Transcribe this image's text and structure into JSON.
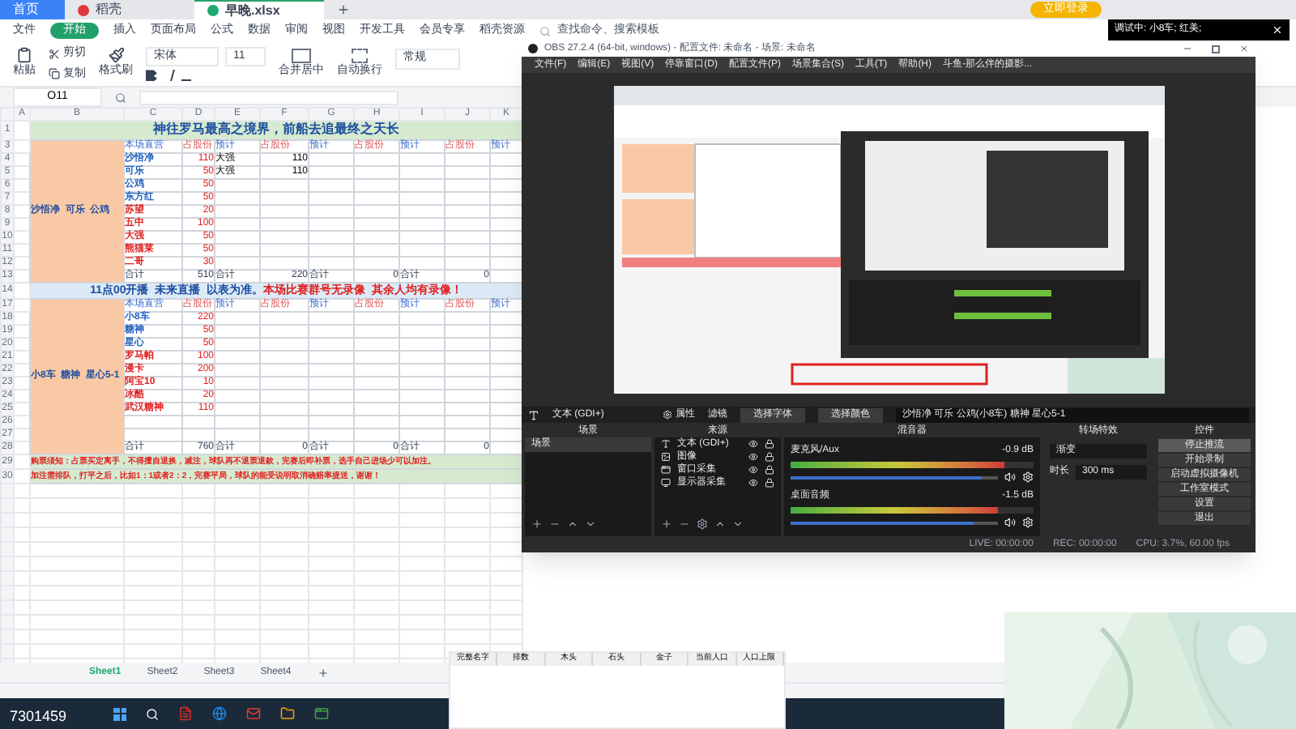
{
  "tabs": [
    {
      "label": "首页",
      "kind": "home",
      "selected": false
    },
    {
      "label": "稻壳",
      "kind": "docer",
      "selected": false
    },
    {
      "label": "早晚.xlsx",
      "kind": "sheet",
      "selected": true
    }
  ],
  "login": "立即登录",
  "menu": [
    {
      "label": "文件",
      "selected": false
    },
    {
      "label": "开始",
      "selected": true
    },
    {
      "label": "插入",
      "selected": false
    },
    {
      "label": "页面布局",
      "selected": false
    },
    {
      "label": "公式",
      "selected": false
    },
    {
      "label": "数据",
      "selected": false
    },
    {
      "label": "审阅",
      "selected": false
    },
    {
      "label": "视图",
      "selected": false
    },
    {
      "label": "开发工具",
      "selected": false
    },
    {
      "label": "会员专享",
      "selected": false
    },
    {
      "label": "稻壳资源",
      "selected": false
    }
  ],
  "search": {
    "placeholder": "查找命令、搜索模板"
  },
  "toolbar": {
    "paste": "粘贴",
    "cut": "剪切",
    "copy": "复制",
    "painter": "格式刷",
    "font": "宋体",
    "size": "11",
    "merge": "合并居中",
    "wrap": "自动换行",
    "format": "常规"
  },
  "name_box": "O11",
  "notification": {
    "text": "调试中: 小8车; 红美;"
  },
  "sheet": {
    "columns": [
      "A",
      "B",
      "C",
      "D",
      "E",
      "F",
      "G",
      "H",
      "I",
      "J",
      "K"
    ],
    "title": {
      "num": "1",
      "text": "神往罗马最高之境界，前船去追最终之天长"
    },
    "groups": [
      {
        "label": "沙悟净  可乐  公鸡",
        "rows": [
          {
            "num": "3",
            "kind": "header",
            "cells": [
              "本场直营",
              "占股份",
              "预计",
              "占股份",
              "预计",
              "占股份",
              "预计",
              "占股份",
              "预计"
            ]
          },
          {
            "num": "4",
            "kind": "entry",
            "color": "#1f5fbf",
            "cells": [
              "沙悟净",
              "110",
              "大强",
              "110"
            ]
          },
          {
            "num": "5",
            "kind": "entry",
            "color": "#1f5fbf",
            "cells": [
              "可乐",
              "50",
              "大强",
              "110"
            ]
          },
          {
            "num": "6",
            "kind": "entry",
            "color": "#1f5fbf",
            "cells": [
              "公鸡",
              "50"
            ]
          },
          {
            "num": "7",
            "kind": "entry",
            "color": "#1f5fbf",
            "cells": [
              "东方红",
              "50"
            ]
          },
          {
            "num": "8",
            "kind": "entry",
            "color": "#e02020",
            "cells": [
              "苏望",
              "20"
            ]
          },
          {
            "num": "9",
            "kind": "entry",
            "color": "#e02020",
            "cells": [
              "五中",
              "100"
            ]
          },
          {
            "num": "10",
            "kind": "entry",
            "color": "#e02020",
            "cells": [
              "大强",
              "50"
            ]
          },
          {
            "num": "11",
            "kind": "entry",
            "color": "#e02020",
            "cells": [
              "熊猫莱",
              "50"
            ]
          },
          {
            "num": "12",
            "kind": "entry",
            "color": "#e02020",
            "cells": [
              "二哥",
              "30"
            ]
          },
          {
            "num": "13",
            "kind": "total",
            "cells": [
              "合计",
              "510",
              "合计",
              "220",
              "合计",
              "0",
              "合计",
              "0"
            ]
          }
        ]
      },
      {
        "label": "11点00开播  未来直播  以表为准。",
        "alert": "本场比赛群号无录像  其余人均有录像！",
        "num": "14",
        "kind": "banner"
      },
      {
        "label": "小8车  糖神  星心5-1",
        "rows": [
          {
            "num": "17",
            "kind": "header",
            "cells": [
              "本场直营",
              "占股份",
              "预计",
              "占股份",
              "预计",
              "占股份",
              "预计",
              "占股份",
              "预计"
            ]
          },
          {
            "num": "18",
            "kind": "entry",
            "color": "#1f5fbf",
            "cells": [
              "小8车",
              "220"
            ]
          },
          {
            "num": "19",
            "kind": "entry",
            "color": "#1f5fbf",
            "cells": [
              "糖神",
              "50"
            ]
          },
          {
            "num": "20",
            "kind": "entry",
            "color": "#1f5fbf",
            "cells": [
              "星心",
              "50"
            ]
          },
          {
            "num": "21",
            "kind": "entry",
            "color": "#e02020",
            "cells": [
              "罗马帕",
              "100"
            ]
          },
          {
            "num": "22",
            "kind": "entry",
            "color": "#e02020",
            "cells": [
              "漫卡",
              "200"
            ]
          },
          {
            "num": "23",
            "kind": "entry",
            "color": "#e02020",
            "cells": [
              "阿宝10",
              "10"
            ]
          },
          {
            "num": "24",
            "kind": "entry",
            "color": "#e02020",
            "cells": [
              "冰酷",
              "20"
            ]
          },
          {
            "num": "25",
            "kind": "entry",
            "color": "#e02020",
            "cells": [
              "武汉糖神",
              "110"
            ]
          },
          {
            "num": "26",
            "kind": "blank",
            "cells": []
          },
          {
            "num": "27",
            "kind": "blank",
            "cells": []
          },
          {
            "num": "28",
            "kind": "total",
            "cells": [
              "合计",
              "760",
              "合计",
              "0",
              "合计",
              "0",
              "合计",
              "0"
            ]
          }
        ]
      }
    ],
    "notice": [
      {
        "num": "29",
        "text": "购票须知：占票买定离手，不得擅自退换，减注，球队再不退票退款，完赛后即补票，选手自己进场少可以加注。"
      },
      {
        "num": "30",
        "text": "加注需排队，打平之后，比如1：1或者2：2，完赛平局，球队的能受说明取消确赔率提送，谢谢！"
      }
    ]
  },
  "sheet_tabs": [
    {
      "label": "Sheet1",
      "selected": true
    },
    {
      "label": "Sheet2",
      "selected": false
    },
    {
      "label": "Sheet3",
      "selected": false
    },
    {
      "label": "Sheet4",
      "selected": false
    }
  ],
  "overlay_code": "7301459",
  "obs": {
    "title": "OBS 27.2.4 (64-bit, windows) - 配置文件: 未命名 - 场景: 未命名",
    "menu": [
      "文件(F)",
      "编辑(E)",
      "视图(V)",
      "停靠窗口(D)",
      "配置文件(P)",
      "场景集合(S)",
      "工具(T)",
      "帮助(H)",
      "斗鱼-那么伴的摄影..."
    ],
    "source_bar": {
      "source": "文本 (GDI+)",
      "properties": "属性",
      "filters": "滤镜",
      "font": "选择字体",
      "color_button": "选择颜色",
      "text": "沙悟净 可乐 公鸡(小8车) 糖神 星心5-1"
    },
    "docks": {
      "scenes": "场景",
      "sources": "来源",
      "mixer": "混音器",
      "transitions": "转场特效",
      "controls": "控件"
    },
    "scenes": [
      {
        "label": "场景",
        "selected": true
      }
    ],
    "sources": [
      {
        "label": "文本 (GDI+)",
        "kind": "text"
      },
      {
        "label": "图像"
      },
      {
        "label": "窗口采集",
        "kind": "window"
      },
      {
        "label": "显示器采集",
        "kind": "monitor"
      }
    ],
    "channels": [
      {
        "name": "麦克风/Aux",
        "reading": "-0.9 dB",
        "level": 0.88,
        "fader": {
          "level": 0.92
        }
      },
      {
        "name": "桌面音频",
        "reading": "-1.5 dB",
        "level": 0.85,
        "fader": {
          "level": 0.88
        }
      }
    ],
    "transition": {
      "type": "渐变",
      "duration_label": "时长",
      "duration": "300 ms"
    },
    "controls": [
      "停止推流",
      "开始录制",
      "启动虚拟摄像机",
      "工作室模式",
      "设置",
      "退出"
    ],
    "status": {
      "live": "LIVE: 00:00:00",
      "rec": "REC: 00:00:00",
      "cpu": "CPU: 3.7%, 60.00 fps"
    }
  },
  "popup_table": {
    "columns": [
      "完整名字",
      "排数",
      "木头",
      "石头",
      "金子",
      "当前人口",
      "人口上限"
    ]
  }
}
